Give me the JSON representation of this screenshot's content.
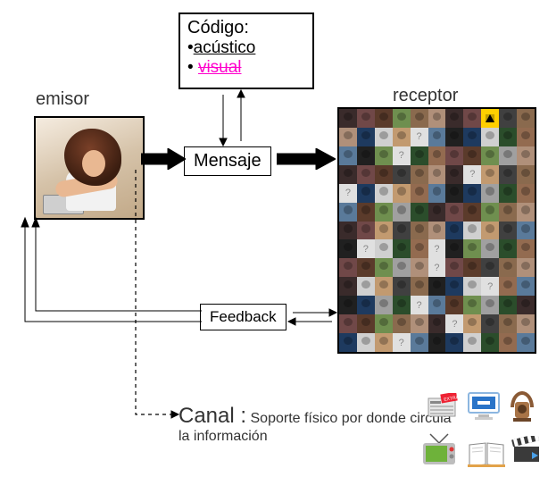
{
  "labels": {
    "emisor": "emisor",
    "receptor": "receptor"
  },
  "codigo": {
    "title": "Código:",
    "item1": "acústico",
    "item2": "visual"
  },
  "mensaje": "Mensaje",
  "feedback": "Feedback",
  "canal": {
    "title": "Canal :",
    "desc": "Soporte físico por donde circula la información"
  },
  "avatar_grid": {
    "cols": 11,
    "rows": 13,
    "palette": [
      "#3a2b2b",
      "#8a6a4e",
      "#c29a70",
      "#1e3a5f",
      "#5a7a9a",
      "#2b4d2b",
      "#6f8f4f",
      "#704848",
      "#b0907a",
      "#404040",
      "#d0d0d0",
      "#202020",
      "#936b50",
      "#a0a0a0",
      "#5b3b2b"
    ],
    "qmark_cells": [
      15,
      25,
      40,
      44,
      78,
      82,
      93,
      107,
      114,
      127,
      135
    ],
    "warn_cells": [
      8
    ]
  }
}
